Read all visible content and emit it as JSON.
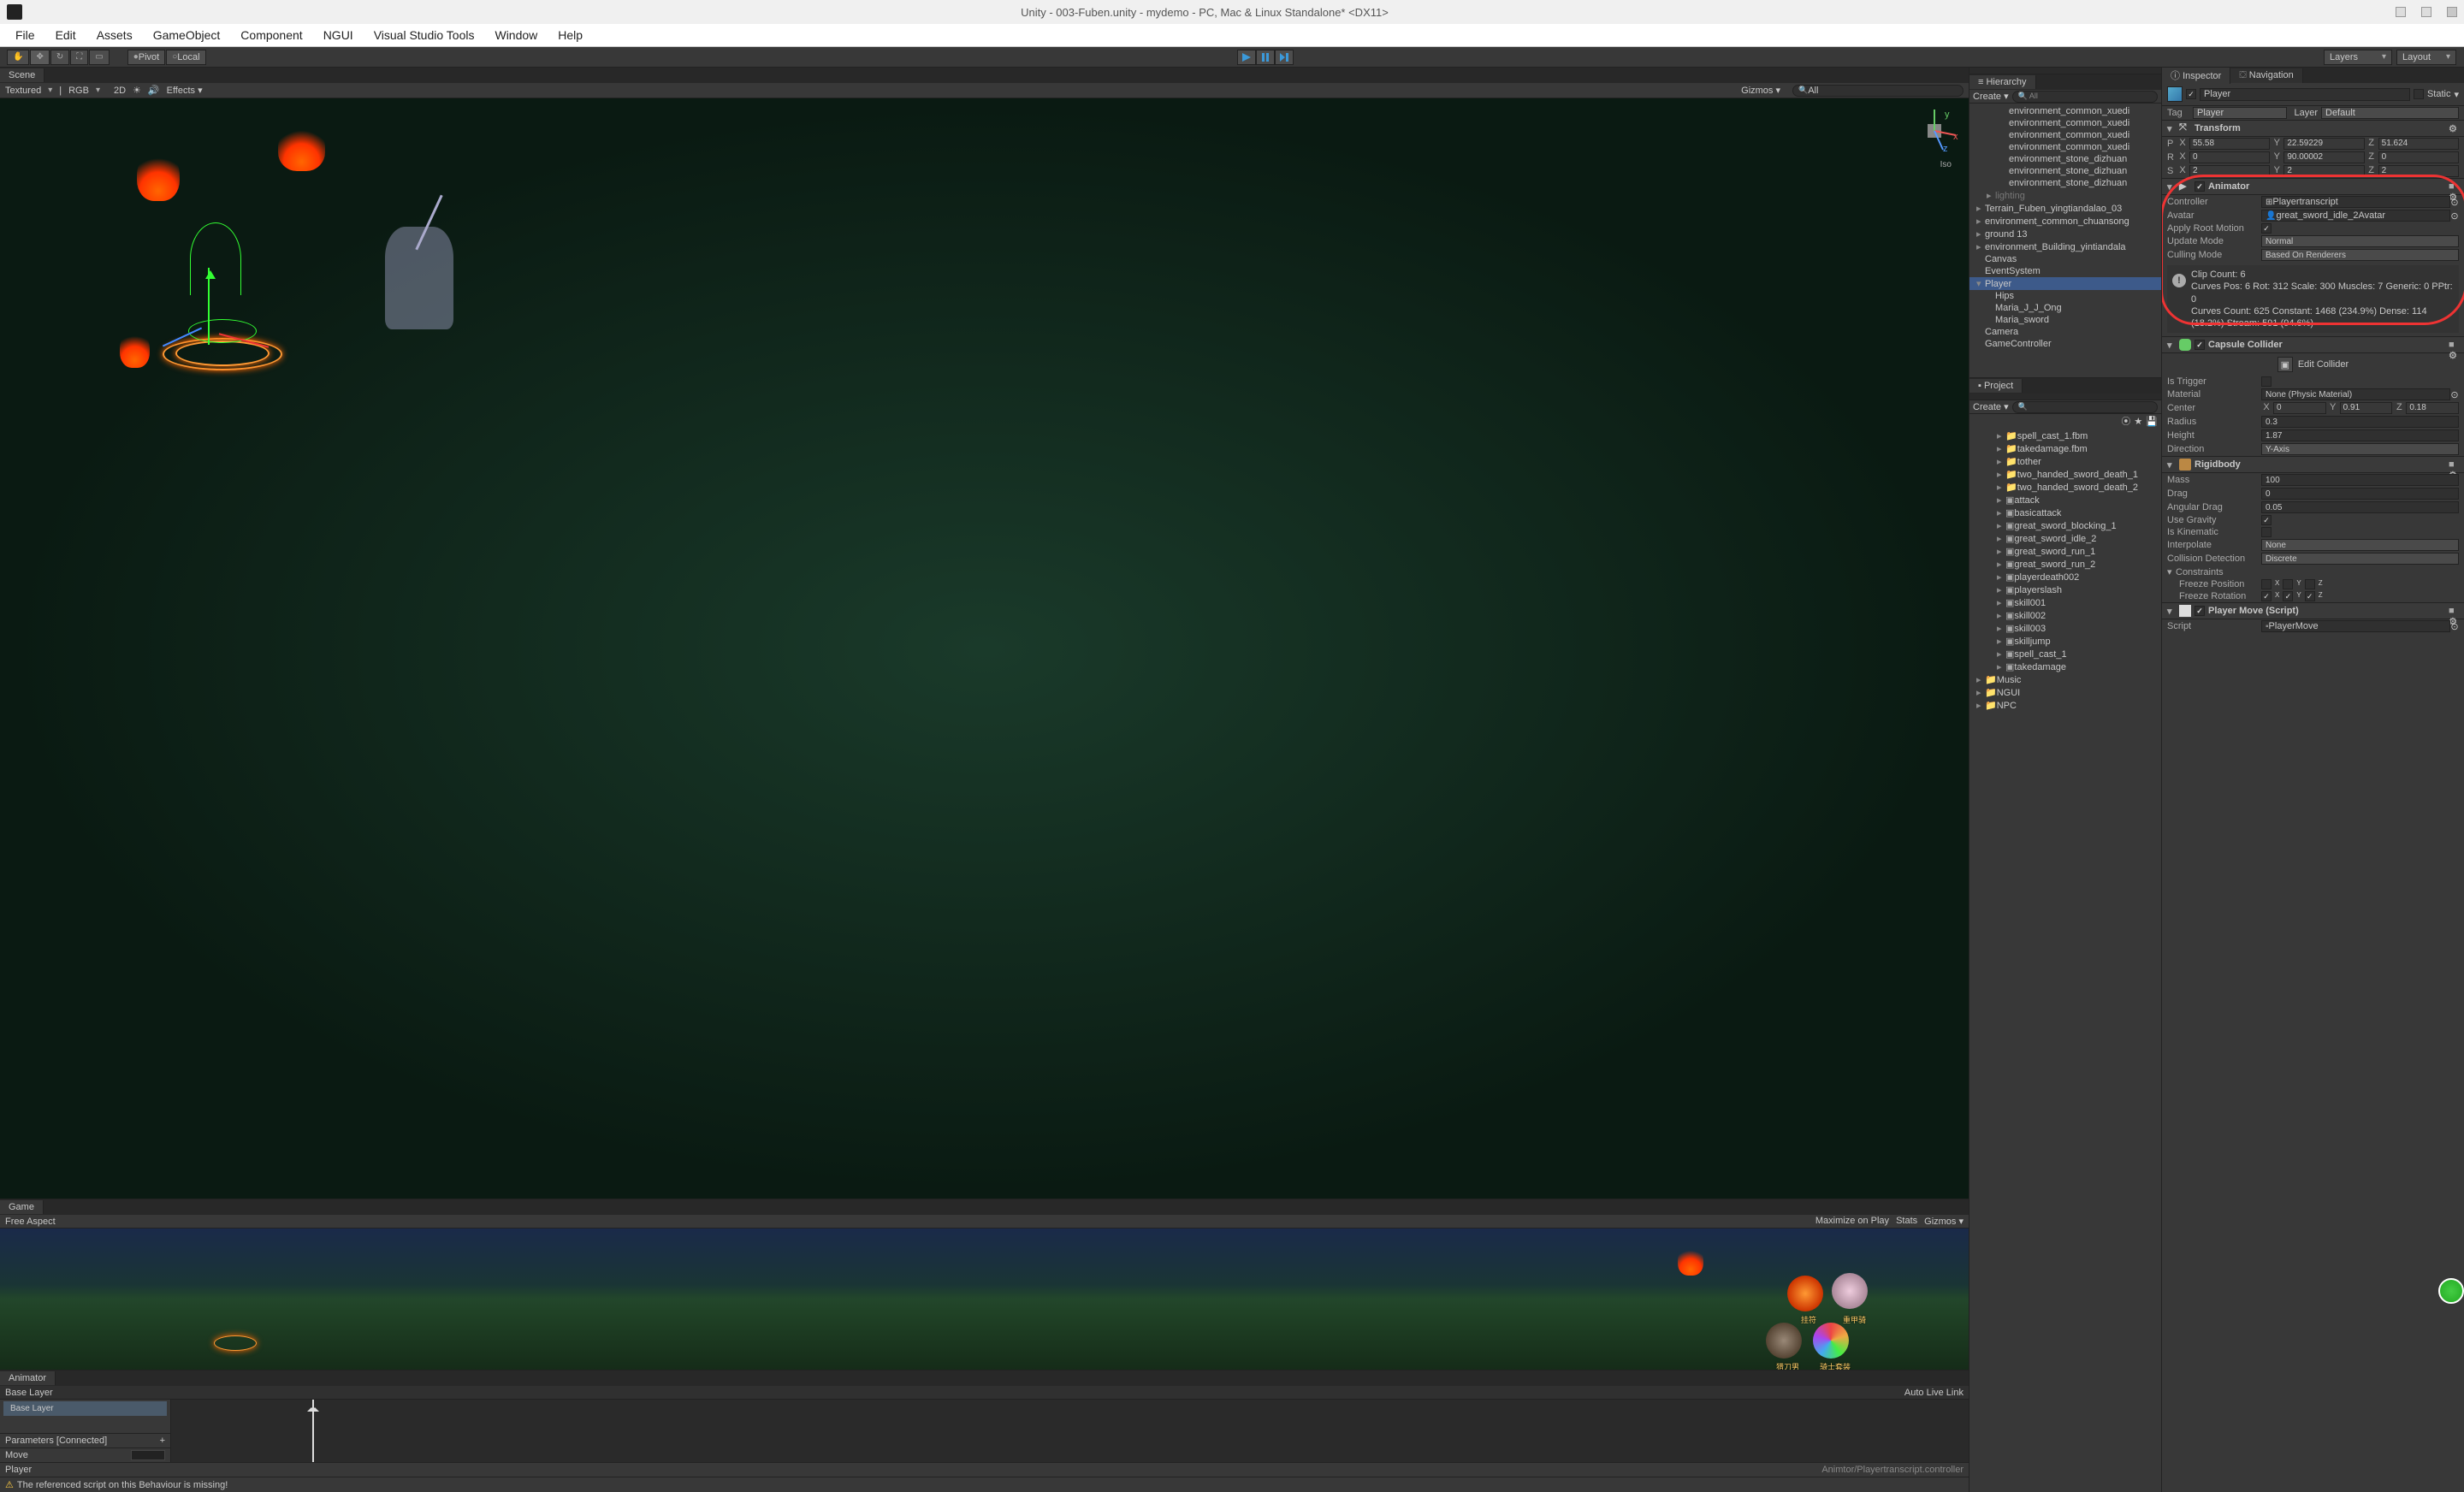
{
  "titlebar": {
    "title": "Unity - 003-Fuben.unity - mydemo - PC, Mac & Linux Standalone* <DX11>"
  },
  "menubar": [
    "File",
    "Edit",
    "Assets",
    "GameObject",
    "Component",
    "NGUI",
    "Visual Studio Tools",
    "Window",
    "Help"
  ],
  "toolbar": {
    "pivot": "Pivot",
    "local": "Local",
    "layers": "Layers",
    "layout": "Layout"
  },
  "scene": {
    "tab": "Scene",
    "shading": "Textured",
    "color": "RGB",
    "twoD": "2D",
    "effects": "Effects",
    "gizmos": "Gizmos",
    "search": "All",
    "iso": "Iso"
  },
  "game": {
    "tab": "Game",
    "aspect": "Free Aspect",
    "maximize": "Maximize on Play",
    "stats": "Stats",
    "gizmos": "Gizmos",
    "icons": {
      "a": "挂符",
      "b": "重甲骑",
      "c": "猎刀男",
      "d": "骑士套装"
    }
  },
  "animator_panel": {
    "tab": "Animator",
    "crumb": "Base Layer",
    "layer": "Base Layer",
    "params_label": "Parameters [Connected]",
    "move": "Move",
    "object": "Player",
    "auto_live": "Auto Live Link",
    "path": "Animtor/Playertranscript.controller"
  },
  "errorbar": "The referenced script on this Behaviour is missing!",
  "hierarchy": {
    "tab": "Hierarchy",
    "create": "Create",
    "items": [
      "environment_common_xuedi",
      "environment_common_xuedi",
      "environment_common_xuedi",
      "environment_common_xuedi",
      "environment_stone_dizhuan",
      "environment_stone_dizhuan",
      "environment_stone_dizhuan"
    ],
    "lighting": "lighting",
    "terrain": "Terrain_Fuben_yingtiandalao_03",
    "chuansong": "environment_common_chuansong",
    "ground": "ground 13",
    "building": "environment_Building_yintiandala",
    "canvas": "Canvas",
    "eventsystem": "EventSystem",
    "player": "Player",
    "hips": "Hips",
    "maria": "Maria_J_J_Ong",
    "sword": "Maria_sword",
    "camera": "Camera",
    "gamecontroller": "GameController"
  },
  "project": {
    "tab": "Project",
    "create": "Create",
    "items": [
      "spell_cast_1.fbm",
      "takedamage.fbm",
      "tother",
      "two_handed_sword_death_1",
      "two_handed_sword_death_2",
      "attack",
      "basicattack",
      "great_sword_blocking_1",
      "great_sword_idle_2",
      "great_sword_run_1",
      "great_sword_run_2",
      "playerdeath002",
      "playerslash",
      "skill001",
      "skill002",
      "skill003",
      "skilljump",
      "spell_cast_1",
      "takedamage"
    ],
    "music": "Music",
    "ngui": "NGUI",
    "npc": "NPC"
  },
  "inspector": {
    "tab_inspector": "Inspector",
    "tab_navigation": "Navigation",
    "obj_name": "Player",
    "static": "Static",
    "tag_label": "Tag",
    "tag_value": "Player",
    "layer_label": "Layer",
    "layer_value": "Default",
    "transform": {
      "title": "Transform",
      "px": "55.58",
      "py": "22.59229",
      "pz": "51.624",
      "rx": "0",
      "ry": "90.00002",
      "rz": "0",
      "sx": "2",
      "sy": "2",
      "sz": "2"
    },
    "animator": {
      "title": "Animator",
      "controller_lbl": "Controller",
      "controller_val": "Playertranscript",
      "avatar_lbl": "Avatar",
      "avatar_val": "great_sword_idle_2Avatar",
      "root_motion_lbl": "Apply Root Motion",
      "update_mode_lbl": "Update Mode",
      "update_mode_val": "Normal",
      "culling_mode_lbl": "Culling Mode",
      "culling_mode_val": "Based On Renderers",
      "clip_info": "Clip Count: 6\nCurves Pos: 6 Rot: 312 Scale: 300 Muscles: 7 Generic: 0 PPtr: 0\nCurves Count: 625 Constant: 1468 (234.9%) Dense: 114 (18.2%) Stream: 591 (94.6%)"
    },
    "capsule": {
      "title": "Capsule Collider",
      "edit": "Edit Collider",
      "trigger_lbl": "Is Trigger",
      "material_lbl": "Material",
      "material_val": "None (Physic Material)",
      "center_lbl": "Center",
      "cx": "0",
      "cy": "0.91",
      "cz": "0.18",
      "radius_lbl": "Radius",
      "radius_val": "0.3",
      "height_lbl": "Height",
      "height_val": "1.87",
      "direction_lbl": "Direction",
      "direction_val": "Y-Axis"
    },
    "rigidbody": {
      "title": "Rigidbody",
      "mass_lbl": "Mass",
      "mass_val": "100",
      "drag_lbl": "Drag",
      "drag_val": "0",
      "angdrag_lbl": "Angular Drag",
      "angdrag_val": "0.05",
      "gravity_lbl": "Use Gravity",
      "kinematic_lbl": "Is Kinematic",
      "interp_lbl": "Interpolate",
      "interp_val": "None",
      "coll_lbl": "Collision Detection",
      "coll_val": "Discrete",
      "constraints_lbl": "Constraints",
      "freeze_pos_lbl": "Freeze Position",
      "freeze_rot_lbl": "Freeze Rotation"
    },
    "playermove": {
      "title": "Player Move (Script)",
      "script_lbl": "Script",
      "script_val": "PlayerMove"
    }
  }
}
